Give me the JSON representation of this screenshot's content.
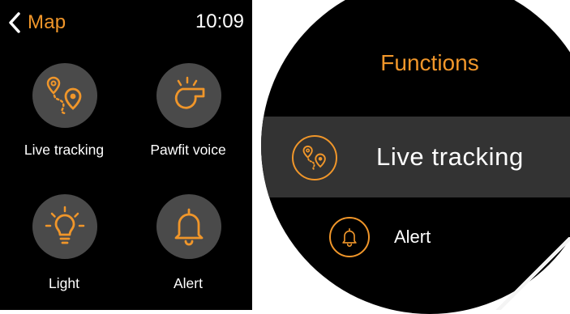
{
  "square_screen": {
    "header": {
      "back_label": "Map",
      "time": "10:09"
    },
    "apps": [
      {
        "label": "Live tracking",
        "icon": "location-route-icon"
      },
      {
        "label": "Pawfit voice",
        "icon": "whistle-icon"
      },
      {
        "label": "Light",
        "icon": "lightbulb-icon"
      },
      {
        "label": "Alert",
        "icon": "bell-icon"
      }
    ]
  },
  "round_screen": {
    "title": "Functions",
    "items": [
      {
        "label": "Live tracking",
        "icon": "location-route-icon",
        "selected": true
      },
      {
        "label": "Alert",
        "icon": "bell-icon",
        "selected": false
      }
    ]
  },
  "colors": {
    "accent": "#f0962a",
    "screen_bg": "#000000",
    "tile_bg": "#4a4a4a",
    "selected_row": "#333333",
    "text": "#ffffff"
  }
}
